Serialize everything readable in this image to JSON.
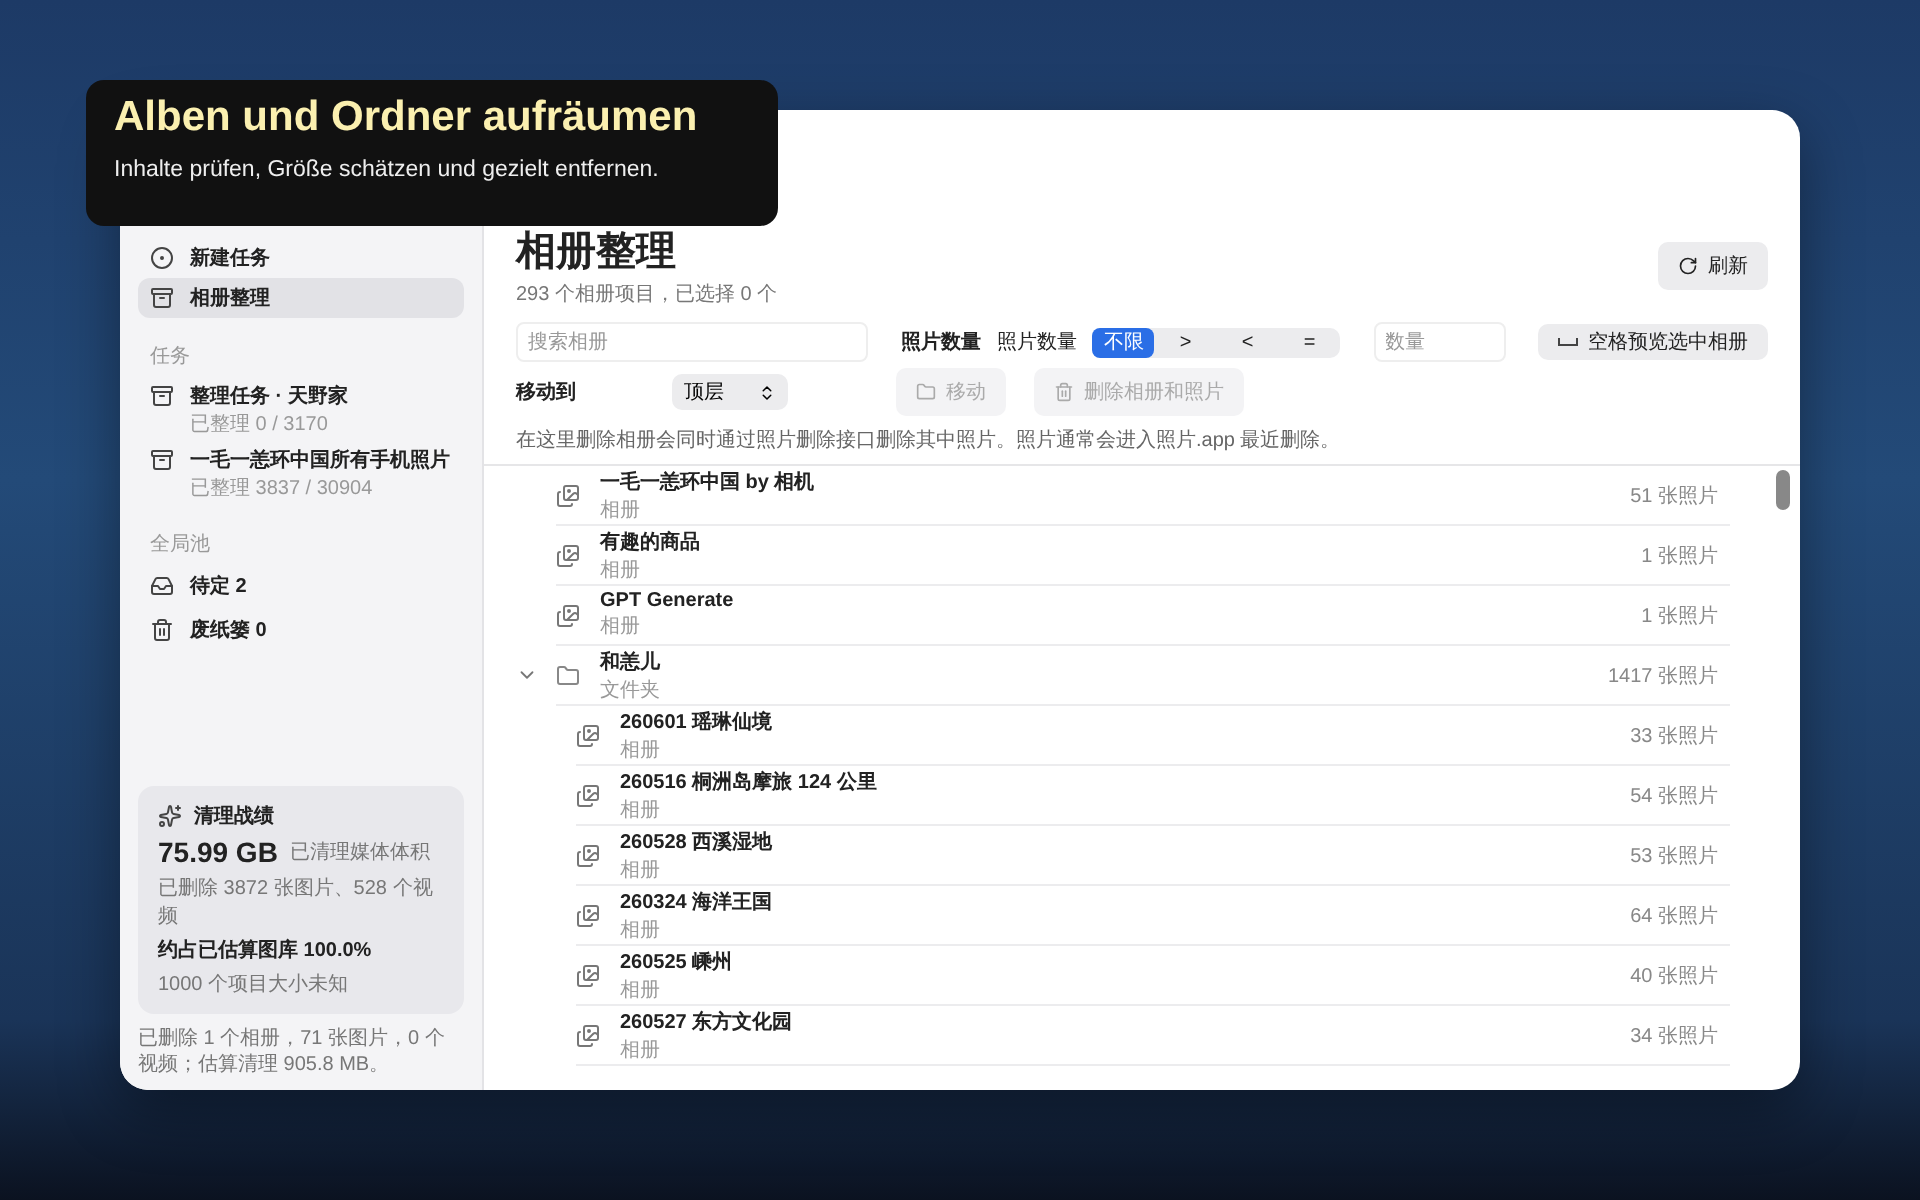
{
  "banner": {
    "title": "Alben und Ordner aufräumen",
    "subtitle": "Inhalte prüfen, Größe schätzen und gezielt entfernen."
  },
  "sidebar": {
    "items": [
      {
        "label": "新建任务",
        "kind": "new",
        "selected": false
      },
      {
        "label": "相册整理",
        "kind": "albums",
        "selected": true
      }
    ],
    "tasks_heading": "任务",
    "tasks": [
      {
        "title": "整理任务 · 天野家",
        "progress": "已整理 0 / 3170"
      },
      {
        "title": "一毛一恙环中国所有手机照片",
        "progress": "已整理 3837 / 30904"
      }
    ],
    "pool_heading": "全局池",
    "pool": [
      {
        "label": "待定 2",
        "kind": "pending"
      },
      {
        "label": "废纸篓 0",
        "kind": "trash"
      }
    ],
    "stats": {
      "title": "清理战绩",
      "size": "75.99 GB",
      "size_caption": "已清理媒体体积",
      "deleted": "已删除 3872 张图片、528 个视频",
      "share": "约占已估算图库 100.0%",
      "unknown": "1000 个项目大小未知"
    },
    "footer_note": "已删除 1 个相册，71 张图片，0 个视频；估算清理 905.8 MB。"
  },
  "header": {
    "title": "相册整理",
    "summary": "293 个相册项目，已选择 0 个",
    "refresh": "刷新"
  },
  "filters": {
    "search_placeholder": "搜索相册",
    "count_label": "照片数量",
    "segment_label": "照片数量",
    "segments": [
      {
        "label": "不限",
        "selected": true
      },
      {
        "label": ">",
        "selected": false
      },
      {
        "label": "<",
        "selected": false
      },
      {
        "label": "=",
        "selected": false
      }
    ],
    "count_placeholder": "数量",
    "preview": "空格预览选中相册"
  },
  "move": {
    "label": "移动到",
    "target": "顶层",
    "move_button": "移动",
    "move_disabled": true,
    "delete_button": "删除相册和照片",
    "delete_disabled": true
  },
  "note": "在这里删除相册会同时通过照片删除接口删除其中照片。照片通常会进入照片.app 最近删除。",
  "albums": [
    {
      "name": "一毛一恙环中国 by 相机",
      "type": "相册",
      "kind": "album",
      "count": "51 张照片"
    },
    {
      "name": "有趣的商品",
      "type": "相册",
      "kind": "album",
      "count": "1 张照片"
    },
    {
      "name": "GPT Generate",
      "type": "相册",
      "kind": "album",
      "count": "1 张照片"
    },
    {
      "name": "和恙儿",
      "type": "文件夹",
      "kind": "folder",
      "count": "1417 张照片",
      "expanded": true,
      "children": [
        {
          "name": "260601 瑶琳仙境",
          "type": "相册",
          "kind": "album",
          "count": "33 张照片"
        },
        {
          "name": "260516 桐洲岛摩旅 124 公里",
          "type": "相册",
          "kind": "album",
          "count": "54 张照片"
        },
        {
          "name": "260528 西溪湿地",
          "type": "相册",
          "kind": "album",
          "count": "53 张照片"
        },
        {
          "name": "260324 海洋王国",
          "type": "相册",
          "kind": "album",
          "count": "64 张照片"
        },
        {
          "name": "260525 嵊州",
          "type": "相册",
          "kind": "album",
          "count": "40 张照片"
        },
        {
          "name": "260527 东方文化园",
          "type": "相册",
          "kind": "album",
          "count": "34 张照片"
        }
      ]
    }
  ]
}
